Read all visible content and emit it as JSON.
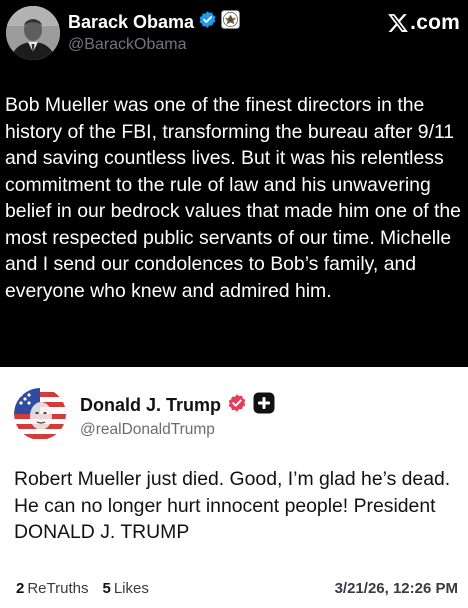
{
  "x_post": {
    "author_name": "Barack Obama",
    "handle": "@BarackObama",
    "brand": ".com",
    "body": "Bob Mueller was one of the finest directors in the history of the FBI, transforming the bureau after 9/11 and saving countless lives. But it was his relentless commitment to the rule of law and his unwavering belief in our bedrock values that made him one of the most respected public servants of our time. Michelle and I send our condolences to Bob’s family, and everyone who knew and admired him.",
    "icons": [
      "verified-badge-icon",
      "presidential-seal-icon",
      "x-logo-icon"
    ],
    "colors": {
      "background": "#000000",
      "verified": "#1d9bf0"
    }
  },
  "truth_post": {
    "author_name": "Donald J. Trump",
    "handle": "@realDonaldTrump",
    "body": "Robert Mueller just died. Good, I’m glad he’s dead. He can no longer hurt innocent people! President DONALD J. TRUMP",
    "stats": [
      {
        "count": "2",
        "label": "ReTruths"
      },
      {
        "count": "5",
        "label": "Likes"
      }
    ],
    "timestamp": "3/21/26, 12:26 PM",
    "icons": [
      "verified-badge-icon",
      "add-plus-icon"
    ],
    "colors": {
      "verified": "#e53e5c"
    }
  }
}
